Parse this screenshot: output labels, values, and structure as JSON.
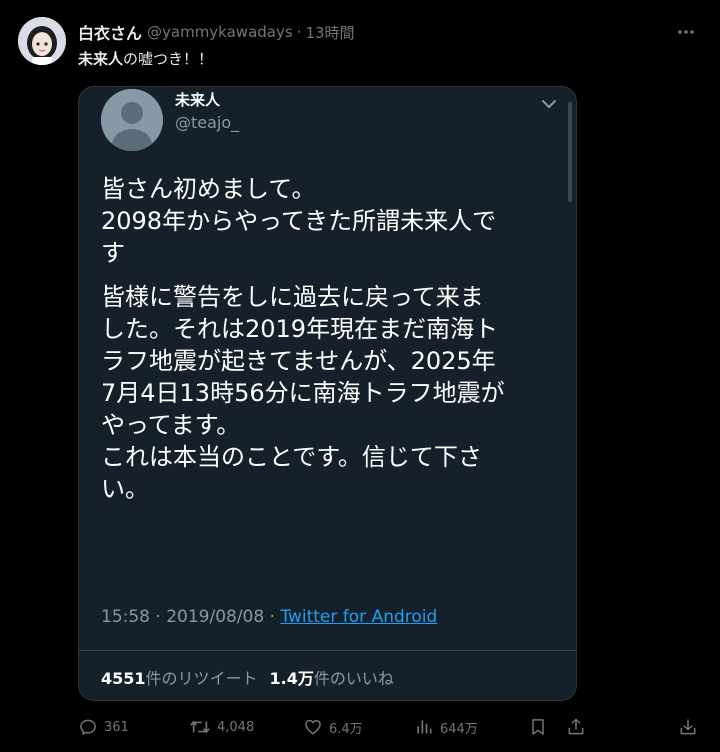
{
  "author": {
    "display_name": "白衣さん",
    "handle": "@yammykawadays",
    "separator": "·",
    "time": "13時間"
  },
  "tweet": {
    "text_bold": "未来人",
    "text_rest": "の嘘つき！！"
  },
  "quoted": {
    "name": "未来人",
    "handle": "@teajo_",
    "lines": [
      "皆さん初めまして。",
      "2098年からやってきた所謂未来人で",
      "す",
      "皆様に警告をしに過去に戻って来ま",
      "した。それは2019年現在まだ南海ト",
      "ラフ地震が起きてませんが、2025年",
      "7月4日13時56分に南海トラフ地震が",
      "やってます。",
      "これは本当のことです。信じて下さ",
      "い。"
    ],
    "meta_time": "15:58 · 2019/08/08 · ",
    "source": "Twitter for Android",
    "retweets_num": "4551",
    "retweets_label": "件のリツイート",
    "likes_num": "1.4万",
    "likes_label": "件のいいね"
  },
  "actions": {
    "replies": "361",
    "retweets": "4,048",
    "likes": "6.4万",
    "views": "644万"
  },
  "colors": {
    "background": "#000000",
    "card_background": "#15202b",
    "link": "#1da1f2",
    "muted": "#71767b"
  },
  "icons": [
    "more-icon",
    "chevron-down-icon",
    "reply-icon",
    "retweet-icon",
    "like-icon",
    "views-icon",
    "bookmark-icon",
    "share-icon",
    "download-icon"
  ]
}
